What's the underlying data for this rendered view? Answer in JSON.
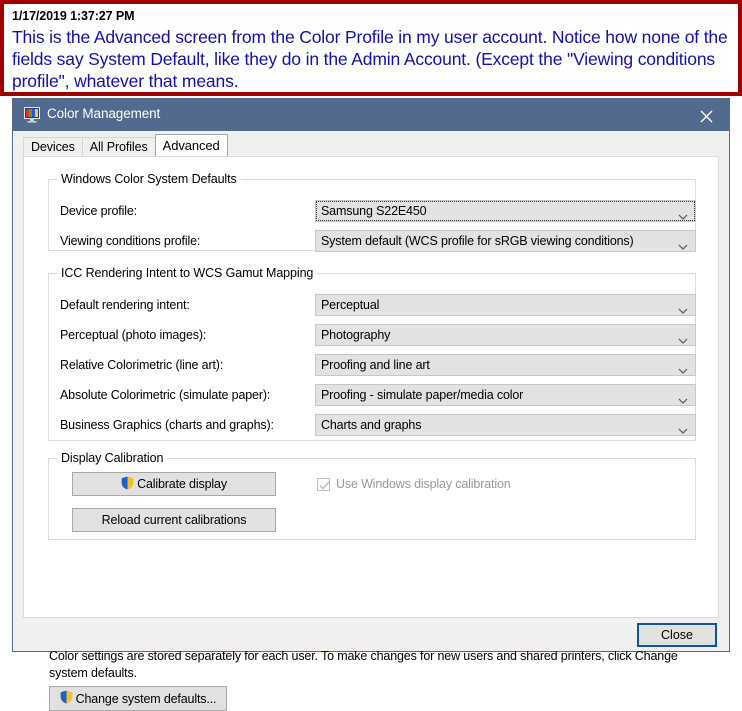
{
  "annotation": {
    "timestamp": "1/17/2019 1:37:27 PM",
    "note": "This is the Advanced screen from the Color Profile in my user account. Notice how none of the fields say System Default, like they do in the Admin Account. (Except the \"Viewing conditions profile\", whatever that means.",
    "border_color": "#a00000",
    "note_color": "#1111aa"
  },
  "window": {
    "title": "Color Management",
    "icon": "color-management-monitor-icon",
    "close_icon": "close-icon",
    "titlebar_color": "#526a8e"
  },
  "tabs": [
    {
      "label": "Devices",
      "active": false
    },
    {
      "label": "All Profiles",
      "active": false
    },
    {
      "label": "Advanced",
      "active": true
    }
  ],
  "groups": {
    "wcs_defaults": {
      "legend": "Windows Color System Defaults",
      "fields": [
        {
          "label": "Device profile:",
          "value": "Samsung S22E450",
          "focused": true
        },
        {
          "label": "Viewing conditions profile:",
          "value": "System default (WCS profile for sRGB viewing conditions)",
          "focused": false
        }
      ]
    },
    "icc_mapping": {
      "legend": "ICC Rendering Intent to WCS Gamut Mapping",
      "fields": [
        {
          "label": "Default rendering intent:",
          "value": "Perceptual",
          "focused": false
        },
        {
          "label": "Perceptual (photo images):",
          "value": "Photography",
          "focused": false
        },
        {
          "label": "Relative Colorimetric (line art):",
          "value": "Proofing and line art",
          "focused": false
        },
        {
          "label": "Absolute Colorimetric (simulate paper):",
          "value": "Proofing - simulate paper/media color",
          "focused": false
        },
        {
          "label": "Business Graphics (charts and graphs):",
          "value": "Charts and graphs",
          "focused": false
        }
      ]
    },
    "display_calibration": {
      "legend": "Display Calibration",
      "calibrate_button": "Calibrate display",
      "reload_button": "Reload current calibrations",
      "checkbox_label": "Use Windows display calibration",
      "checkbox_checked": true,
      "checkbox_disabled": true
    }
  },
  "footer": {
    "note": "Color settings are stored separately for each user. To make changes for new users and shared printers, click Change system defaults.",
    "change_defaults_button": "Change system defaults..."
  },
  "bottom": {
    "close_label": "Close"
  }
}
